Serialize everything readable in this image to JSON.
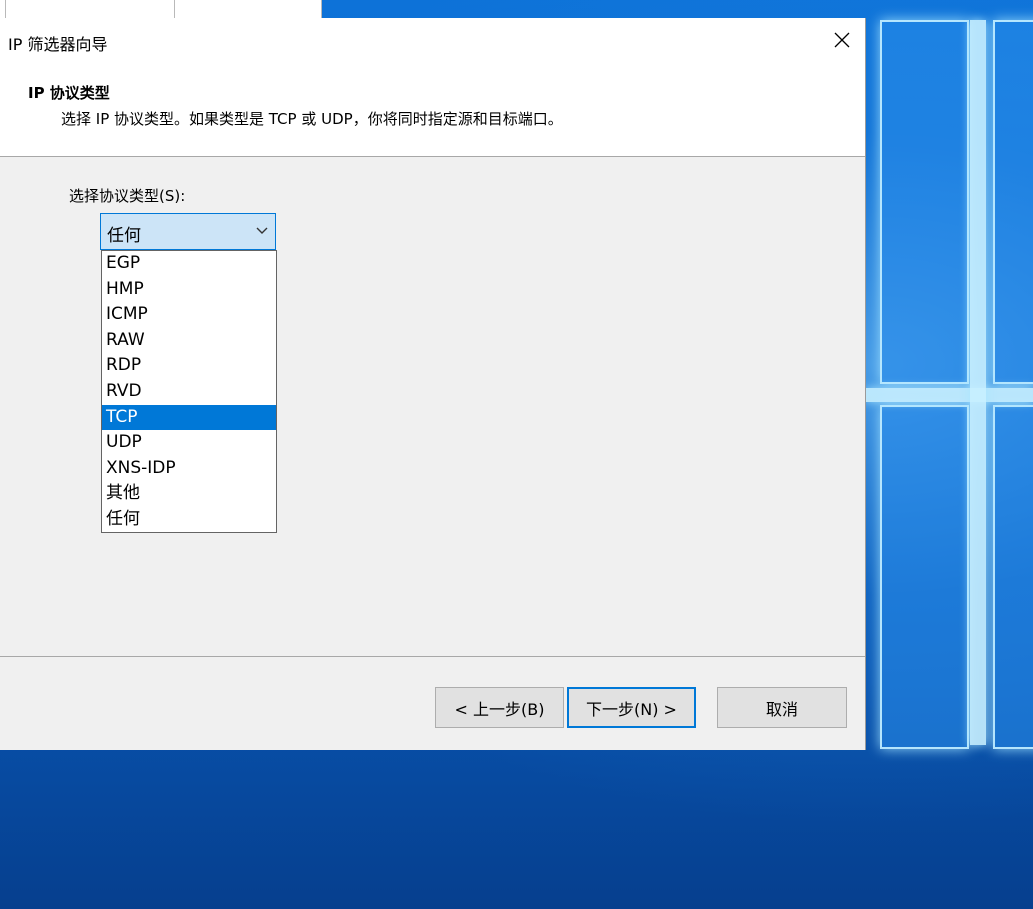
{
  "dialog": {
    "title": "IP 筛选器向导",
    "header_title": "IP 协议类型",
    "header_desc": "选择 IP 协议类型。如果类型是 TCP 或 UDP，你将同时指定源和目标端口。"
  },
  "form": {
    "select_label": "选择协议类型(S):",
    "selected_value": "任何",
    "options": [
      "EGP",
      "HMP",
      "ICMP",
      "RAW",
      "RDP",
      "RVD",
      "TCP",
      "UDP",
      "XNS-IDP",
      "其他",
      "任何"
    ],
    "highlighted_option": "TCP"
  },
  "buttons": {
    "back": "< 上一步(B)",
    "next": "下一步(N) >",
    "cancel": "取消"
  },
  "icons": {
    "close": "close-icon",
    "dropdown": "chevron-down-icon"
  },
  "colors": {
    "accent": "#0078d7",
    "combo_bg": "#cce4f7"
  }
}
